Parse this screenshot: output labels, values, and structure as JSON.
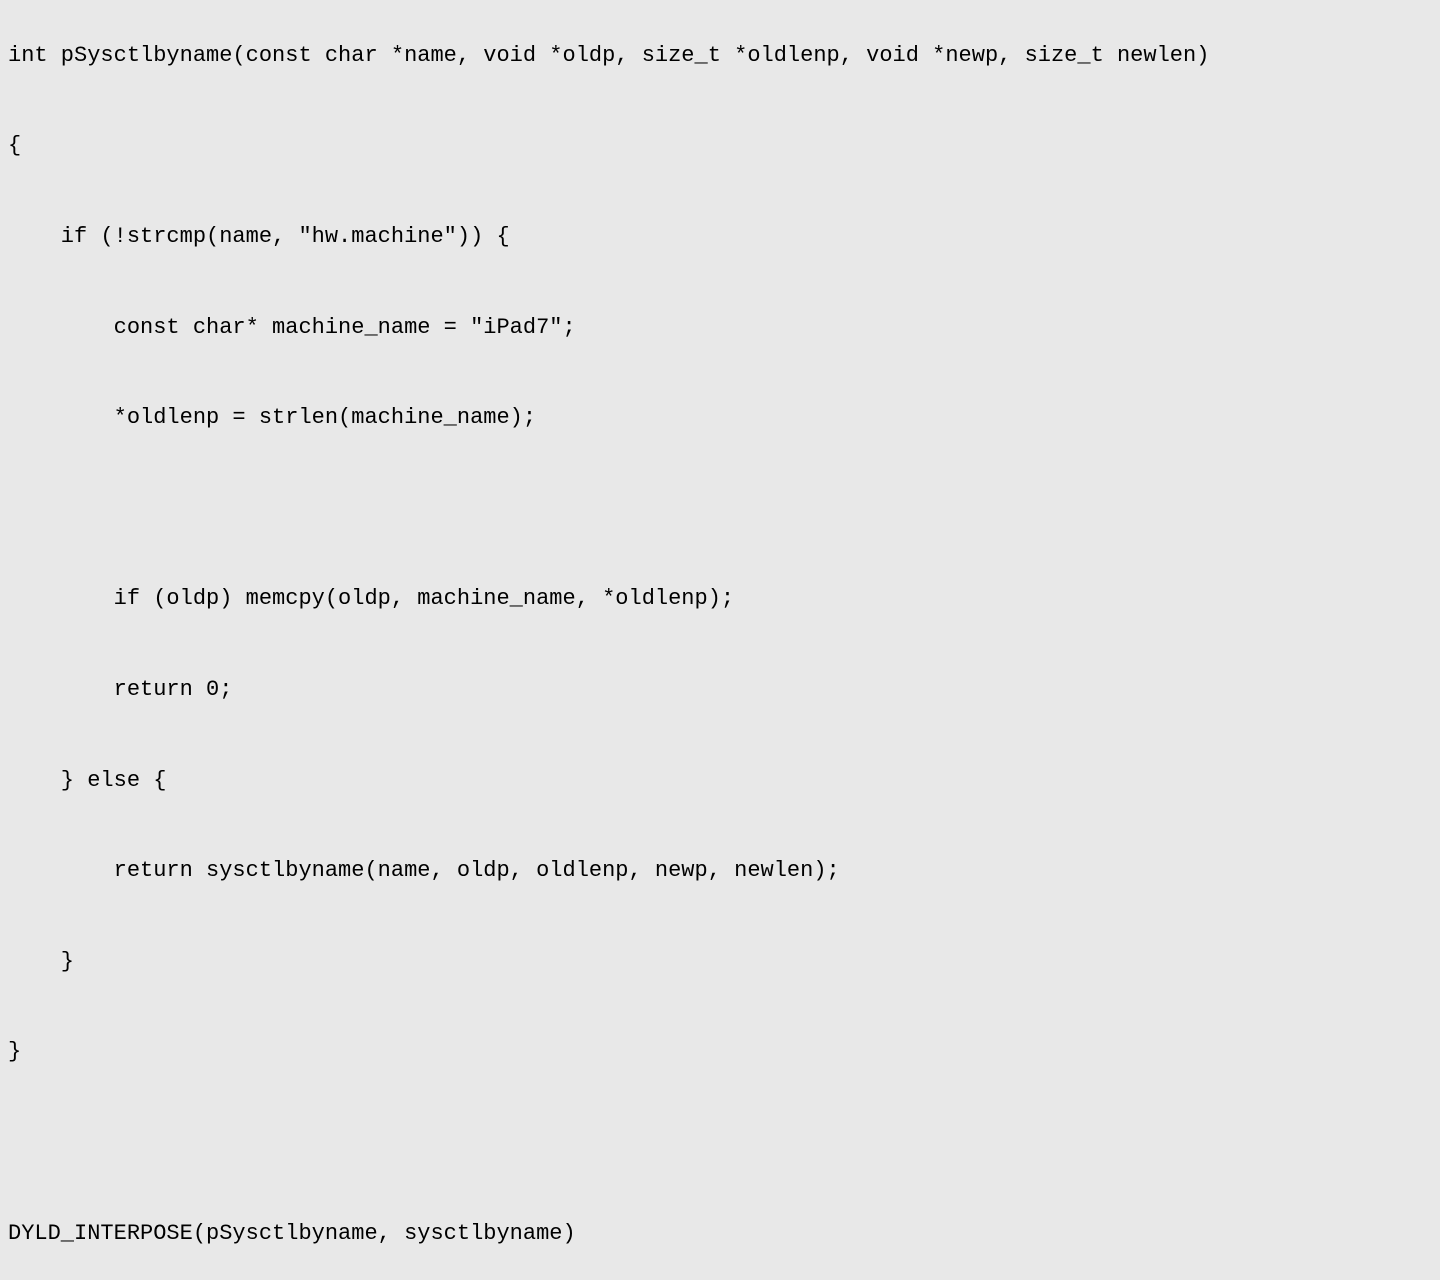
{
  "code": {
    "line1": "int pSysctlbyname(const char *name, void *oldp, size_t *oldlenp, void *newp, size_t newlen)",
    "line2": "{",
    "line3": "    if (!strcmp(name, \"hw.machine\")) {",
    "line4": "        const char* machine_name = \"iPad7\";",
    "line5": "        *oldlenp = strlen(machine_name);",
    "line6": "",
    "line7": "        if (oldp) memcpy(oldp, machine_name, *oldlenp);",
    "line8": "        return 0;",
    "line9": "    } else {",
    "line10": "        return sysctlbyname(name, oldp, oldlenp, newp, newlen);",
    "line11": "    }",
    "line12": "}",
    "line13": "",
    "line14": "DYLD_INTERPOSE(pSysctlbyname, sysctlbyname)"
  }
}
